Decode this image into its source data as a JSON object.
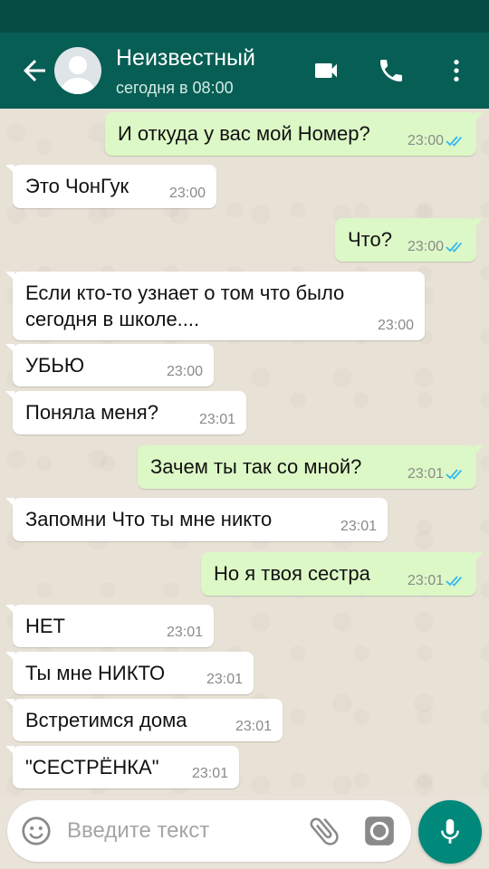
{
  "colors": {
    "header": "#075e54",
    "status_bar": "#054d44",
    "outgoing": "#dcf8c6",
    "incoming": "#ffffff",
    "read_ticks": "#34b7f1",
    "mic": "#00897b"
  },
  "header": {
    "name": "Неизвестный",
    "status": "сегодня в 08:00",
    "icons": [
      "back-arrow-icon",
      "avatar",
      "video-call-icon",
      "phone-icon",
      "more-vert-icon"
    ]
  },
  "messages": [
    {
      "dir": "out",
      "text": "И откуда у вас мой Номер?",
      "time": "23:00",
      "read": true
    },
    {
      "dir": "in",
      "text": "Это ЧонГук",
      "time": "23:00"
    },
    {
      "dir": "out",
      "text": "Что?",
      "time": "23:00",
      "read": true
    },
    {
      "dir": "in",
      "text": "Если кто-то узнает о том что было",
      "text2": "сегодня в школе....",
      "time": "23:00"
    },
    {
      "dir": "in",
      "text": "УБЬЮ",
      "time": "23:00"
    },
    {
      "dir": "in",
      "text": "Поняла меня?",
      "time": "23:01"
    },
    {
      "dir": "out",
      "text": "Зачем ты так со мной?",
      "time": "23:01",
      "read": true
    },
    {
      "dir": "in",
      "text": "Запомни Что ты мне никто",
      "time": "23:01"
    },
    {
      "dir": "out",
      "text": "Но я твоя сестра",
      "time": "23:01",
      "read": true
    },
    {
      "dir": "in",
      "text": "НЕТ",
      "time": "23:01"
    },
    {
      "dir": "in",
      "text": "Ты мне НИКТО",
      "time": "23:01"
    },
    {
      "dir": "in",
      "text": "Встретимся дома",
      "time": "23:01"
    },
    {
      "dir": "in",
      "text": "\"СЕСТРЁНКА\"",
      "time": "23:01"
    }
  ],
  "composer": {
    "placeholder": "Введите текст",
    "icons": [
      "emoji-icon",
      "attach-icon",
      "camera-icon",
      "mic-icon"
    ]
  }
}
